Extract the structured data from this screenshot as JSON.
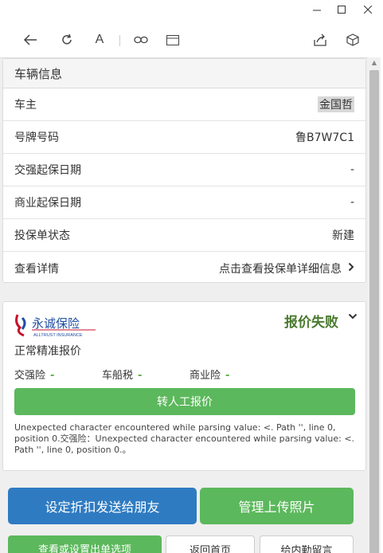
{
  "window": {
    "minimize_icon": "minimize-icon",
    "maximize_icon": "maximize-icon",
    "close_icon": "close-icon"
  },
  "toolbar": {
    "icons": [
      "back-arrow-icon",
      "refresh-icon",
      "font-size-icon",
      "link-icon",
      "window-icon",
      "share-icon",
      "cube-icon"
    ]
  },
  "vehicle": {
    "header": "车辆信息",
    "rows": [
      {
        "label": "车主",
        "value": "金国哲"
      },
      {
        "label": "号牌号码",
        "value": "鲁B7W7C1"
      },
      {
        "label": "交强起保日期",
        "value": "-"
      },
      {
        "label": "商业起保日期",
        "value": "-"
      },
      {
        "label": "投保单状态",
        "value": "新建"
      },
      {
        "label": "查看详情",
        "value": "点击查看投保单详细信息"
      }
    ]
  },
  "quote": {
    "company_logo": "永诚保险",
    "company_logo_en": "ALLTRUST INSURANCE",
    "status": "报价失败",
    "type": "正常精准报价",
    "fees": [
      {
        "label": "交强险",
        "value": "-"
      },
      {
        "label": "车船税",
        "value": "-"
      },
      {
        "label": "商业险",
        "value": "-"
      }
    ],
    "manual_button": "转人工报价",
    "error": "Unexpected character encountered while parsing value: <. Path '', line 0, position 0.交强险：Unexpected character encountered while parsing value: <. Path '', line 0, position 0.。"
  },
  "actions": {
    "share_discount": "设定折扣发送给朋友",
    "upload_photos": "管理上传照片",
    "view_settings": "查看或设置出单选项",
    "back_home": "返回首页",
    "leave_message": "给内勤留言"
  },
  "colors": {
    "green": "#5cb85c",
    "blue": "#2f7bc1",
    "status_green": "#4a7a2e",
    "logo_red": "#c8102e",
    "logo_blue": "#1f4ea3"
  }
}
